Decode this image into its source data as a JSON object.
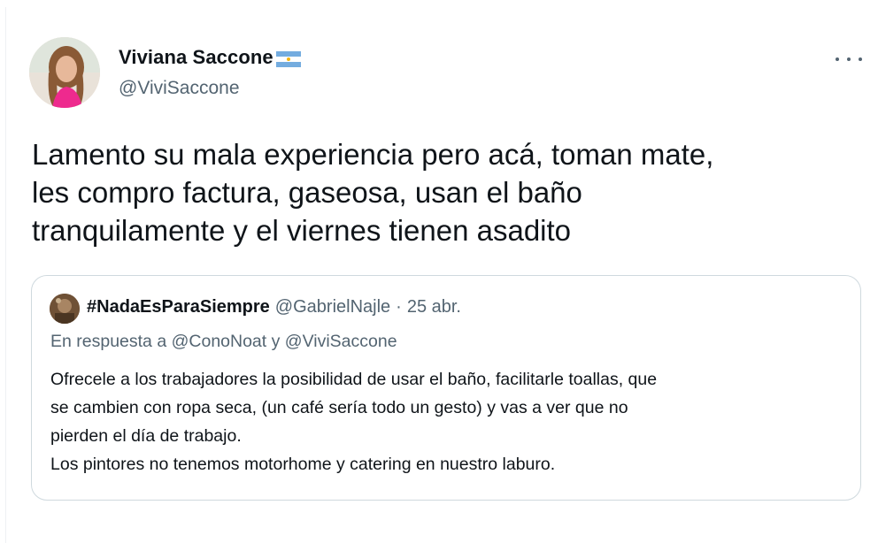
{
  "tweet": {
    "author_name": "Viviana Saccone",
    "author_flag": "argentina-flag-emoji",
    "author_handle": "@ViviSaccone",
    "more_icon": "more-horizontal-icon",
    "text": "Lamento su mala experiencia pero acá, toman mate,\nles compro factura, gaseosa, usan el baño\ntranquilamente y el viernes tienen asadito"
  },
  "quoted": {
    "author_name": "#NadaEsParaSiempre",
    "author_handle": "@GabrielNajle",
    "separator": "·",
    "date": "25 abr.",
    "reply_prefix": "En respuesta a",
    "reply_to_1": "@ConoNoat",
    "reply_joiner": "y",
    "reply_to_2": "@ViviSaccone",
    "text": "Ofrecele a los trabajadores la posibilidad de usar el baño, facilitarle toallas, que\nse cambien con ropa seca, (un café sería todo un gesto) y vas a ver que no\npierden el día de trabajo.\nLos pintores no tenemos motorhome y catering en nuestro laburo."
  },
  "colors": {
    "text_primary": "#0f1419",
    "text_secondary": "#536471",
    "border": "#cfd9de",
    "flag_blue": "#74acdf"
  }
}
